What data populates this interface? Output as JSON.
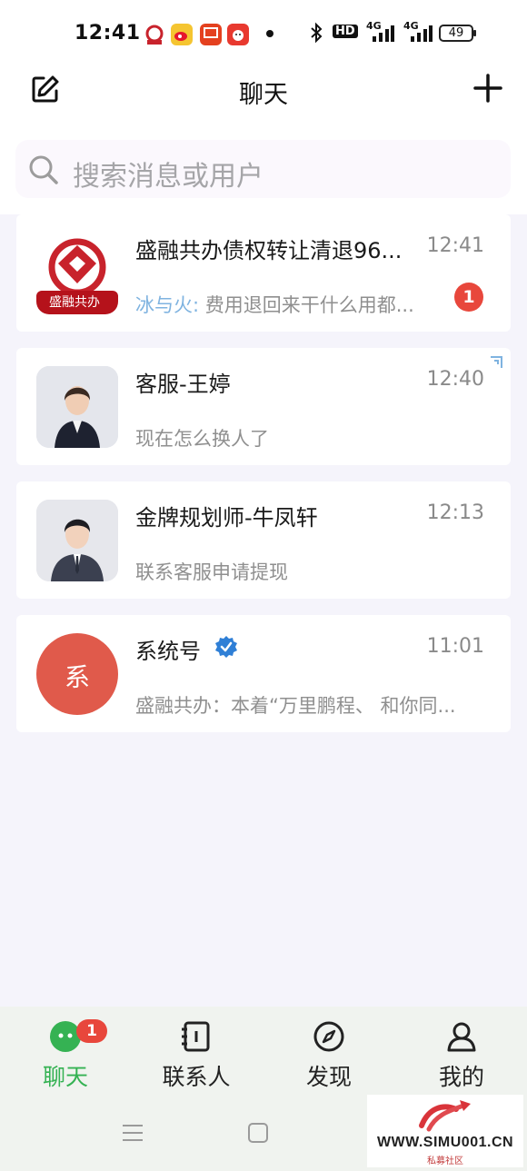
{
  "status_bar": {
    "time": "12:41",
    "network_1": "4G",
    "network_2": "4G",
    "hd": "HD",
    "battery": "49"
  },
  "header": {
    "title": "聊天",
    "edit_icon": "edit-icon",
    "plus_icon": "plus-icon"
  },
  "search": {
    "placeholder": "搜索消息或用户"
  },
  "chats": [
    {
      "name": "盛融共办债权转让清退96...",
      "time": "12:41",
      "sender": "冰与火:",
      "preview": " 费用退回来干什么用都...",
      "unread": "1",
      "avatar_label": "盛融共办"
    },
    {
      "name": "客服-王婷",
      "time": "12:40",
      "preview": "现在怎么换人了"
    },
    {
      "name": "金牌规划师-牛凤轩",
      "time": "12:13",
      "preview": "联系客服申请提现"
    },
    {
      "name": "系统号",
      "time": "11:01",
      "preview": "盛融共办：本着“万里鹏程、 和你同...",
      "avatar_text": "系"
    }
  ],
  "bottom_nav": [
    {
      "label": "聊天",
      "badge": "1",
      "active": true
    },
    {
      "label": "联系人"
    },
    {
      "label": "发现"
    },
    {
      "label": "我的"
    }
  ],
  "watermark": {
    "text": "WWW.SIMU001.CN",
    "sub": "私募社区"
  },
  "colors": {
    "accent_green": "#35b253",
    "badge_red": "#e8473c",
    "system_avatar": "#e05a4b"
  }
}
